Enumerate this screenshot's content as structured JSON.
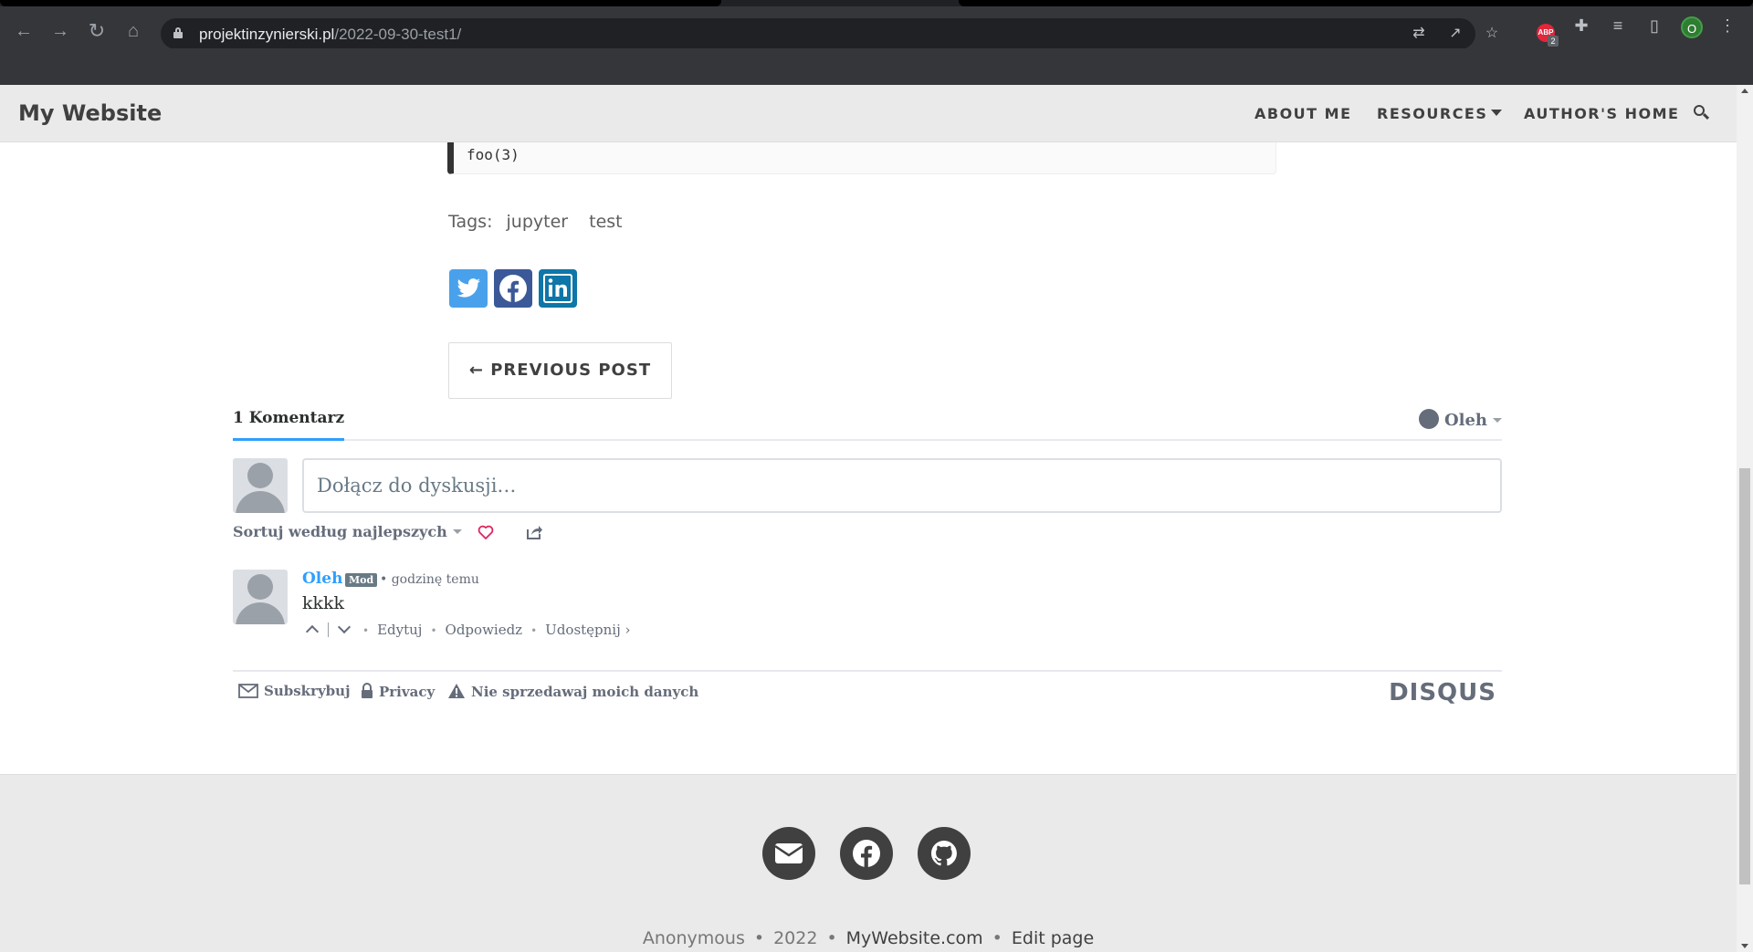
{
  "browser": {
    "url_host": "projektinzynierski.pl",
    "url_path": "/2022-09-30-test1/",
    "profile_initial": "O",
    "adblock_label": "ABP",
    "adblock_count": "2"
  },
  "navbar": {
    "brand": "My Website",
    "links": [
      "ABOUT ME",
      "RESOURCES",
      "AUTHOR'S HOME"
    ]
  },
  "post": {
    "code_line": "foo(3)",
    "tags_label": "Tags:",
    "tags": [
      "jupyter",
      "test"
    ],
    "share": [
      "twitter-icon",
      "facebook-icon",
      "linkedin-icon"
    ],
    "prev_post": "← PREVIOUS POST"
  },
  "disqus": {
    "count_label": "1 Komentarz",
    "user": "Oleh",
    "placeholder": "Dołącz do dyskusji…",
    "sort_label": "Sortuj według najlepszych",
    "comment": {
      "author": "Oleh",
      "badge": "Mod",
      "meta": "• godzinę temu",
      "text": "kkkk",
      "actions": {
        "edit": "Edytuj",
        "reply": "Odpowiedz",
        "share": "Udostępnij ›"
      }
    },
    "footer": {
      "subscribe": "Subskrybuj",
      "privacy": "Privacy",
      "dnsmpi": "Nie sprzedawaj moich danych",
      "logo": "DISQUS"
    },
    "colors": {
      "link": "#2e9fff",
      "muted": "#656c7a"
    }
  },
  "footer": {
    "social": [
      "email-icon",
      "facebook-icon",
      "github-icon"
    ],
    "author": "Anonymous",
    "year": "2022",
    "site": "MyWebsite.com",
    "edit": "Edit page",
    "bullet": "•"
  }
}
